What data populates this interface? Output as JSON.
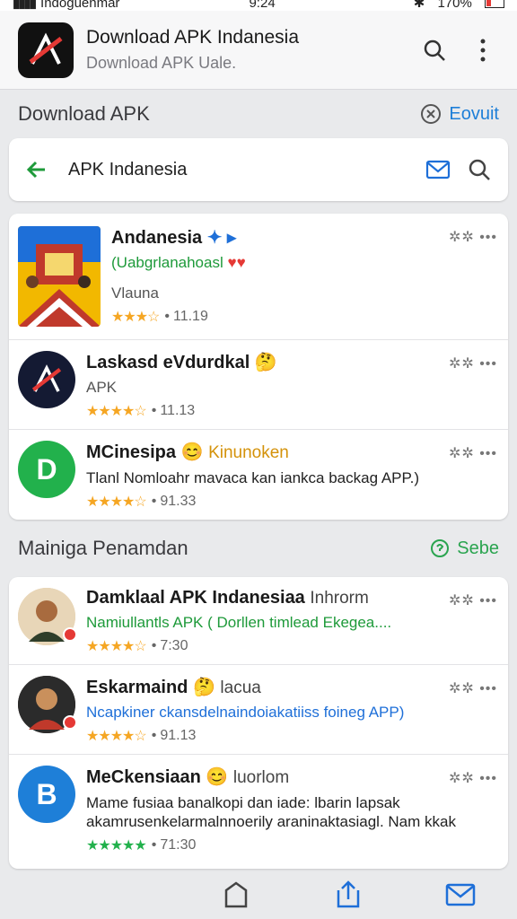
{
  "status": {
    "left": "Indoguenmar",
    "time": "9:24",
    "battery": "170%"
  },
  "appbar": {
    "title": "Download APK Indanesia",
    "subtitle": "Download APK Uale."
  },
  "section1": {
    "label": "Download APK",
    "action": "Eovuit"
  },
  "search": {
    "value": "APK Indanesia"
  },
  "apps": [
    {
      "name": "Andanesia",
      "sub": "(Uabgrlanahoasl",
      "line3": "Vlauna",
      "stars": "★★★☆",
      "rating": "11.19"
    },
    {
      "name": "Laskasd eVdurdkal",
      "sub": "APK",
      "stars": "★★★★☆",
      "rating": "11.13"
    },
    {
      "name": "MCinesipa",
      "extra": "Kinunoken",
      "sub": "Tlanl Nomloahr mavaca kan iankca backag APP.)",
      "stars": "★★★★☆",
      "rating": "91.33"
    }
  ],
  "section2": {
    "label": "Mainiga Penamdan",
    "action": "Sebe"
  },
  "apps2": [
    {
      "name": "Damklaal APK Indanesiaa",
      "extra": "Inhrorm",
      "sub": "Namiullantls APK ( Dorllen timlead Ekegea....",
      "stars": "★★★★☆",
      "rating": "7:30"
    },
    {
      "name": "Eskarmaind",
      "extra": "lacua",
      "sub": "Ncapkiner ckansdelnaindoiakatiiss foineg APP)",
      "stars": "★★★★☆",
      "rating": "91.13"
    },
    {
      "name": "MeCkensiaan",
      "extra": "luorlom",
      "sub": "Mame fusiaa banalkopi dan iade: lbarin lapsak akamrusenkelarmalnnoerily araninaktasiagl. Nam kkak",
      "stars": "★★★★★",
      "rating": "71:30"
    }
  ],
  "colors": {
    "accent": "#1e7fd8",
    "green": "#2aa44f",
    "star": "#f5a623"
  }
}
